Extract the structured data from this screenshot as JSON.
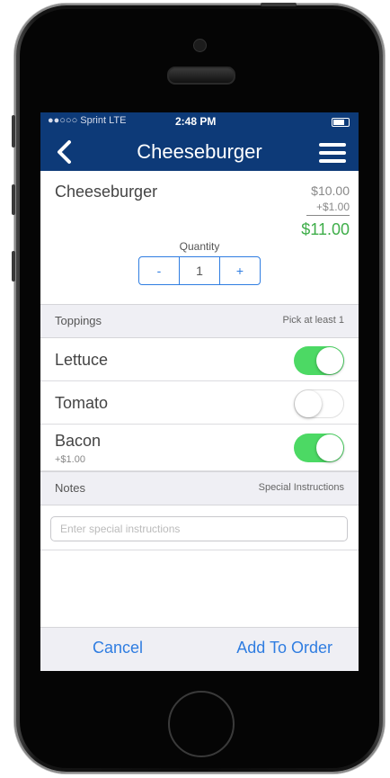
{
  "status_bar": {
    "carrier": "●●○○○ Sprint  LTE",
    "time": "2:48 PM",
    "battery_level": 0.75
  },
  "nav": {
    "back_icon": "chevron-left-icon",
    "title": "Cheeseburger",
    "menu_icon": "hamburger-menu-icon"
  },
  "item": {
    "name": "Cheeseburger",
    "base_price": "$10.00",
    "extra_price": "+$1.00",
    "total_price": "$11.00",
    "total_color": "#3fae4a"
  },
  "quantity": {
    "label": "Quantity",
    "minus": "-",
    "value": "1",
    "plus": "+"
  },
  "toppings": {
    "header": "Toppings",
    "hint": "Pick at least 1",
    "items": [
      {
        "name": "Lettuce",
        "price": "",
        "enabled": true
      },
      {
        "name": "Tomato",
        "price": "",
        "enabled": false
      },
      {
        "name": "Bacon",
        "price": "+$1.00",
        "enabled": true
      }
    ]
  },
  "notes": {
    "header": "Notes",
    "hint": "Special Instructions",
    "placeholder": "Enter special instructions",
    "value": ""
  },
  "actions": {
    "cancel": "Cancel",
    "add": "Add To Order"
  },
  "colors": {
    "nav_bar": "#0d3a78",
    "accent": "#2f7de1",
    "toggle_on": "#4cd964"
  }
}
